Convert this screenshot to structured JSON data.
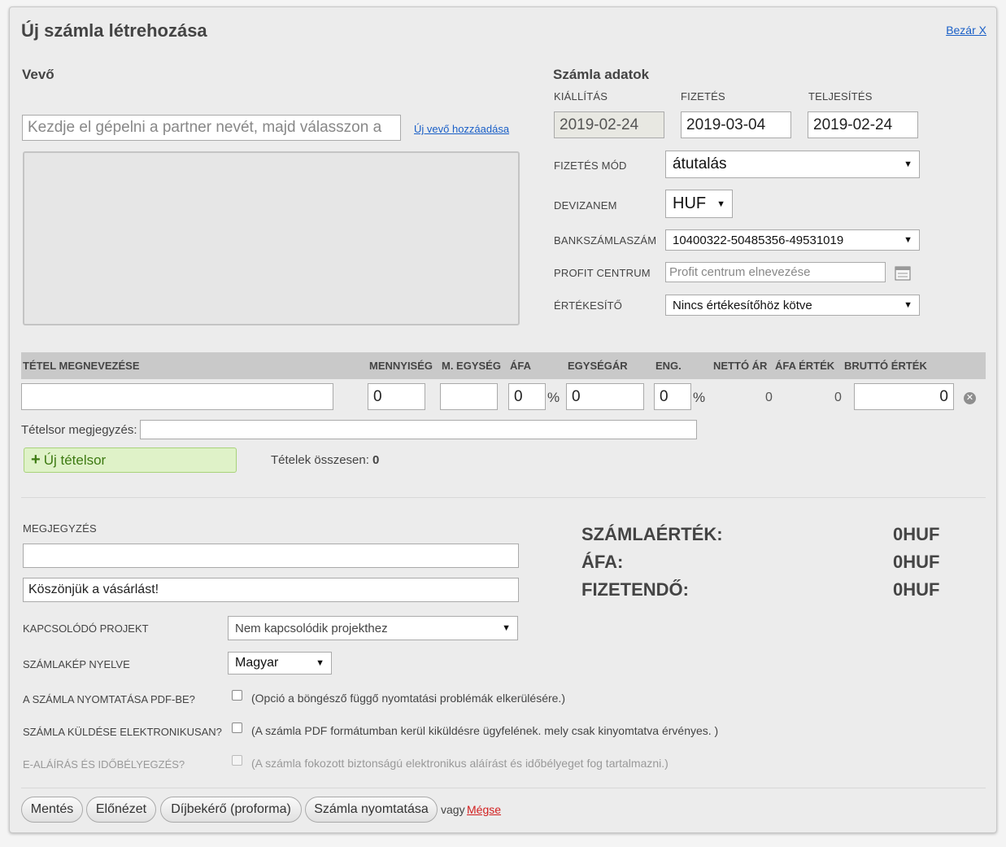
{
  "header": {
    "title": "Új számla létrehozása",
    "close_label": "Bezár X"
  },
  "buyer": {
    "section_title": "Vevő",
    "search_placeholder": "Kezdje el gépelni a partner nevét, majd válasszon a",
    "add_link": "Új vevő hozzáadása"
  },
  "invoice_data": {
    "section_title": "Számla adatok",
    "issue_label": "KIÁLLÍTÁS",
    "issue_value": "2019-02-24",
    "payment_label": "FIZETÉS",
    "payment_value": "2019-03-04",
    "fulfilment_label": "TELJESÍTÉS",
    "fulfilment_value": "2019-02-24",
    "payment_method_label": "FIZETÉS MÓD",
    "payment_method_value": "átutalás",
    "currency_label": "DEVIZANEM",
    "currency_value": "HUF",
    "bank_label": "BANKSZÁMLASZÁM",
    "bank_value": "10400322-50485356-49531019",
    "profit_label": "PROFIT CENTRUM",
    "profit_placeholder": "Profit centrum elnevezése",
    "seller_label": "ÉRTÉKESÍTŐ",
    "seller_value": "Nincs értékesítőhöz kötve"
  },
  "items_table": {
    "headers": {
      "name": "TÉTEL MEGNEVEZÉSE",
      "qty": "MENNYISÉG",
      "unit": "M. EGYSÉG",
      "vat": "ÁFA",
      "unit_price": "EGYSÉGÁR",
      "discount": "ENG.",
      "net": "NETTÓ ÁR",
      "vat_value": "ÁFA ÉRTÉK",
      "gross": "BRUTTÓ ÉRTÉK"
    },
    "row": {
      "name": "",
      "qty": "0",
      "unit": "",
      "vat": "0",
      "vat_pct": "%",
      "unit_price": "0",
      "discount": "0",
      "discount_pct": "%",
      "net": "0",
      "vat_value": "0",
      "gross": "0"
    },
    "note_label": "Tételsor megjegyzés:",
    "note_value": "",
    "add_row_label": "Új tételsor",
    "total_items_label": "Tételek összesen:",
    "total_items_value": "0"
  },
  "notes": {
    "label": "MEGJEGYZÉS",
    "note1": "",
    "note2": "Köszönjük a vásárlást!"
  },
  "totals": {
    "invoice_value_label": "SZÁMLAÉRTÉK:",
    "invoice_value": "0HUF",
    "vat_label": "ÁFA:",
    "vat_value": "0HUF",
    "payable_label": "FIZETENDŐ:",
    "payable_value": "0HUF"
  },
  "options": {
    "project_label": "KAPCSOLÓDÓ PROJEKT",
    "project_value": "Nem kapcsolódik projekthez",
    "language_label": "SZÁMLAKÉP NYELVE",
    "language_value": "Magyar",
    "pdf_label": "A SZÁMLA NYOMTATÁSA PDF-BE?",
    "pdf_help": "(Opció a böngésző függő nyomtatási problémák elkerülésére.)",
    "email_label": "SZÁMLA KÜLDÉSE ELEKTRONIKUSAN?",
    "email_help": "(A számla PDF formátumban kerül kiküldésre ügyfelének. mely csak kinyomtatva érvényes. )",
    "esign_label": "E-ALÁÍRÁS ÉS IDŐBÉLYEGZÉS?",
    "esign_help": "(A számla fokozott biztonságú elektronikus aláírást és időbélyeget fog tartalmazni.)"
  },
  "actions": {
    "save": "Mentés",
    "preview": "Előnézet",
    "proforma": "Díjbekérő (proforma)",
    "print": "Számla nyomtatása",
    "or": "vagy",
    "cancel": "Mégse"
  },
  "colors": {
    "link": "#1a5fc7",
    "cancel": "#d22020",
    "add_row_bg": "#dff2c8",
    "header_bg": "#c9c9c9"
  }
}
